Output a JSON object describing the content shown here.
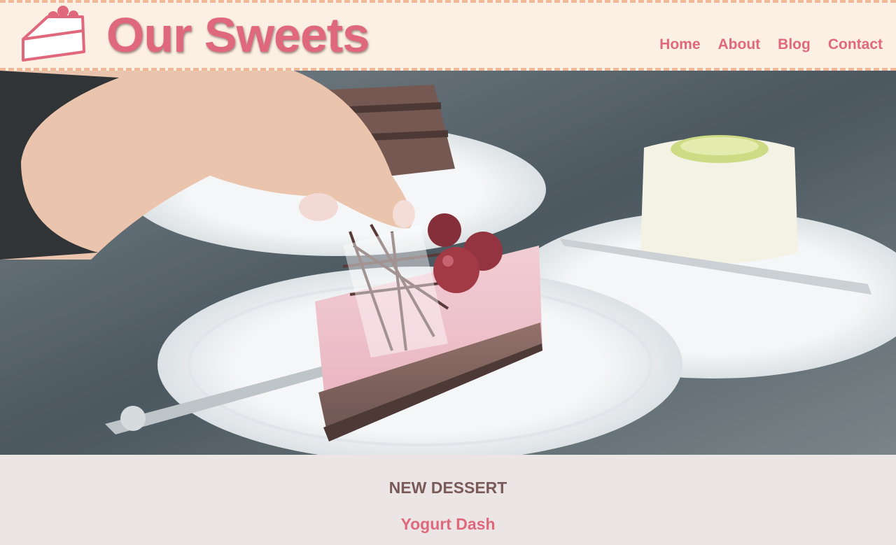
{
  "header": {
    "brand": "Our Sweets",
    "logo_icon": "cake-slice-icon",
    "nav": [
      {
        "label": "Home"
      },
      {
        "label": "About"
      },
      {
        "label": "Blog"
      },
      {
        "label": "Contact"
      }
    ]
  },
  "hero": {
    "image": "cherry-cheesecake-photo"
  },
  "feature": {
    "kicker": "NEW DESSERT",
    "title": "Yogurt Dash"
  },
  "colors": {
    "accent": "#e0687c",
    "header_bg": "#fcf0e4",
    "dash": "#efb896",
    "kicker": "#7a5a57",
    "section_bg": "#ebe6e5"
  }
}
